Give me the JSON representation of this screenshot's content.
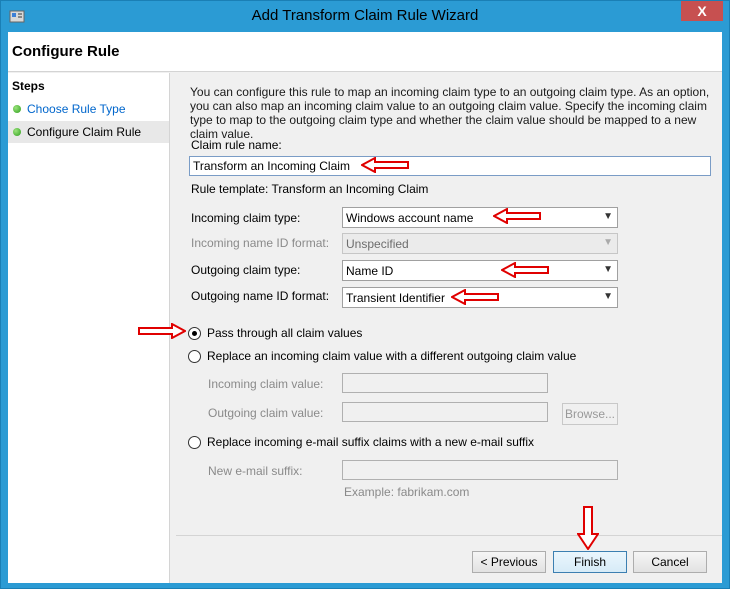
{
  "window": {
    "title": "Add Transform Claim Rule Wizard",
    "close_label": "X"
  },
  "header": {
    "title": "Configure Rule"
  },
  "steps": {
    "title": "Steps",
    "items": [
      {
        "label": "Choose Rule Type"
      },
      {
        "label": "Configure Claim Rule"
      }
    ]
  },
  "main": {
    "intro": "You can configure this rule to map an incoming claim type to an outgoing claim type. As an option, you can also map an incoming claim value to an outgoing claim value. Specify the incoming claim type to map to the outgoing claim type and whether the claim value should be mapped to a new claim value.",
    "claim_rule_name_label": "Claim rule name:",
    "claim_rule_name_value": "Transform an Incoming Claim",
    "rule_template": "Rule template: Transform an Incoming Claim",
    "incoming_claim_type_label": "Incoming claim type:",
    "incoming_claim_type_value": "Windows account name",
    "incoming_name_id_label": "Incoming name ID format:",
    "incoming_name_id_value": "Unspecified",
    "outgoing_claim_type_label": "Outgoing claim type:",
    "outgoing_claim_type_value": "Name ID",
    "outgoing_name_id_label": "Outgoing name ID format:",
    "outgoing_name_id_value": "Transient Identifier",
    "radio_pass": "Pass through all claim values",
    "radio_replace": "Replace an incoming claim value with a different outgoing claim value",
    "incoming_claim_value_label": "Incoming claim value:",
    "outgoing_claim_value_label": "Outgoing claim value:",
    "browse_label": "Browse...",
    "radio_email": "Replace incoming e-mail suffix claims with a new e-mail suffix",
    "new_email_label": "New e-mail suffix:",
    "example_text": "Example: fabrikam.com"
  },
  "footer": {
    "previous_label": "< Previous",
    "finish_label": "Finish",
    "cancel_label": "Cancel"
  },
  "colors": {
    "window_border": "#2b9bd4",
    "close": "#c75050",
    "annotation_arrow": "#e00000",
    "link": "#0066cc"
  }
}
